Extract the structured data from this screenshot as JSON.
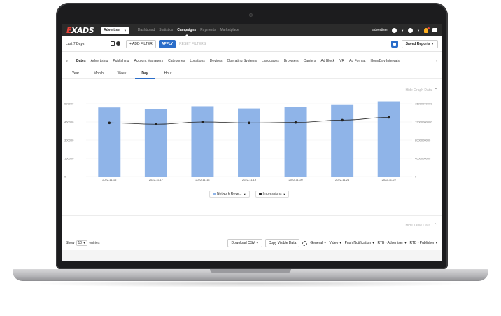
{
  "app": {
    "logo": "EXADS",
    "role": "Advertiser",
    "nav": [
      "Dashboard",
      "Statistics",
      "Campaigns",
      "Payments",
      "Marketplace"
    ],
    "nav_active": "Campaigns",
    "user": "advertiser"
  },
  "filters": {
    "date_range": "Last 7 Days",
    "add_filter": "+ ADD FILTER",
    "apply": "APPLY",
    "reset": "RESET FILTERS",
    "saved_reports": "Saved Reports"
  },
  "dimension_tabs": [
    "Dates",
    "Advertising",
    "Publishing",
    "Account Managers",
    "Categories",
    "Locations",
    "Devices",
    "Operating Systems",
    "Languages",
    "Browsers",
    "Carriers",
    "Ad Block",
    "VR",
    "Ad Format",
    "Hour/Day Intervals"
  ],
  "dimension_active": "Dates",
  "time_tabs": [
    "Year",
    "Month",
    "Week",
    "Day",
    "Hour"
  ],
  "time_active": "Day",
  "hide_graph": "Hide Graph Data",
  "hide_table": "Hide Table Data",
  "chart_data": {
    "type": "bar",
    "categories": [
      "2022-11-16",
      "2022-11-17",
      "2022-11-18",
      "2022-11-19",
      "2022-11-20",
      "2022-11-21",
      "2022-11-22"
    ],
    "series": [
      {
        "name": "Network Reve...",
        "type": "bar",
        "axis": "left",
        "color": "#8fb4e8",
        "values": [
          570000,
          557000,
          580000,
          562000,
          575000,
          590000,
          620000
        ]
      },
      {
        "name": "Impressions",
        "type": "line",
        "axis": "right",
        "color": "#222222",
        "values": [
          11800000,
          11500000,
          12000000,
          11800000,
          11900000,
          12400000,
          13000000
        ]
      }
    ],
    "y_left_ticks": [
      "600000",
      "450000",
      "300000",
      "150000",
      "0"
    ],
    "y_right_ticks": [
      "16000000000",
      "12000000000",
      "8000000000",
      "4000000000",
      "0"
    ],
    "ylim_left": [
      0,
      600000
    ],
    "ylim_right": [
      0,
      16000000
    ],
    "legend_placement": "bottom"
  },
  "table_toolbar": {
    "show": "Show",
    "entries_value": "10",
    "entries": "entries",
    "download": "Download CSV",
    "copy": "Copy Visible Data",
    "groups": [
      "General",
      "Video",
      "Push Notification",
      "RTB - Advertiser",
      "RTB - Publisher"
    ]
  }
}
